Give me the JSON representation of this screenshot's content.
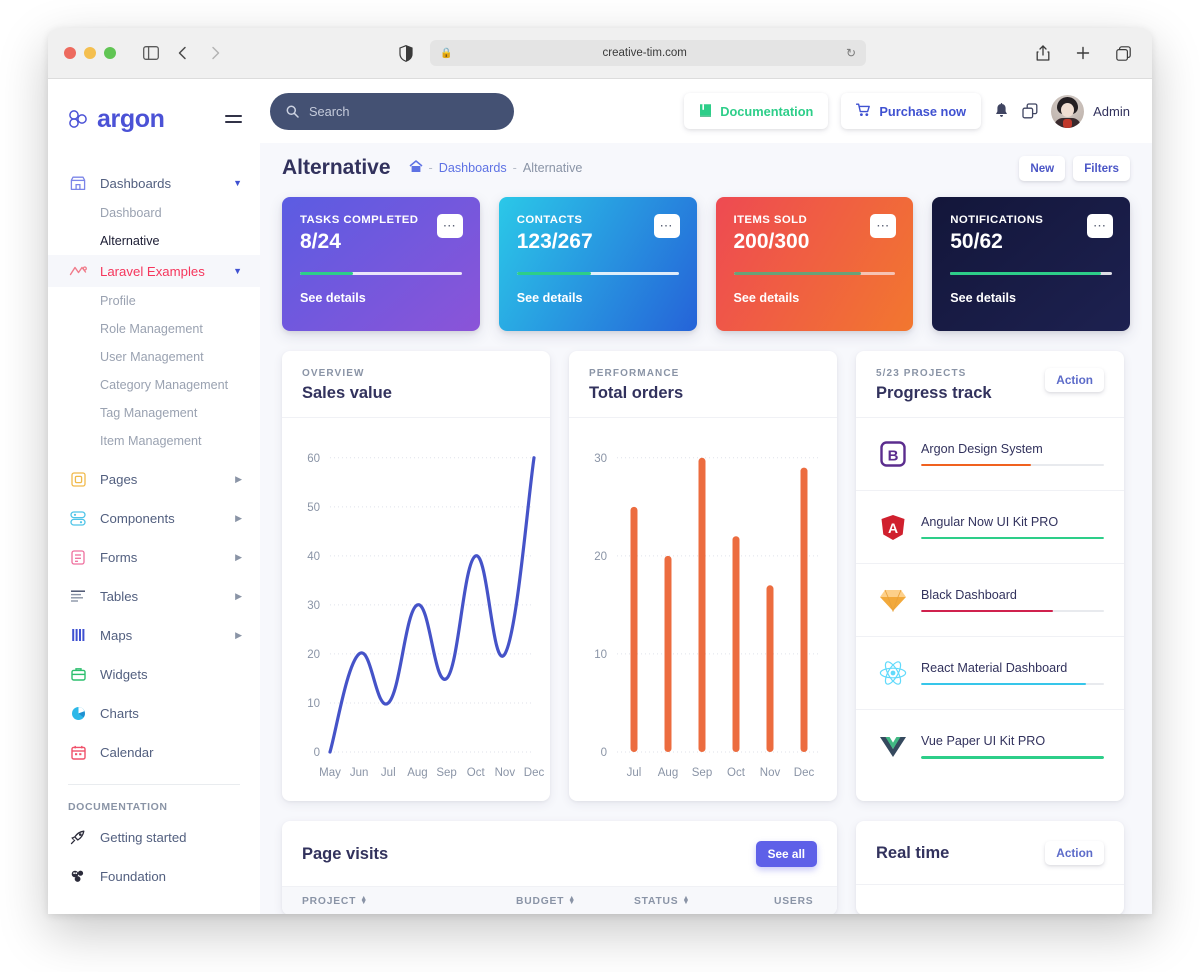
{
  "browser": {
    "url": "creative-tim.com",
    "lock_icon": "lock-icon",
    "reload_icon": "reload-icon"
  },
  "sidebar": {
    "logo_text": "argon",
    "items": [
      {
        "label": "Dashboards",
        "icon": "store-icon",
        "caret": "chevron-down-icon",
        "type": "parent"
      },
      {
        "label": "Dashboard",
        "type": "sub",
        "state": "dim"
      },
      {
        "label": "Alternative",
        "type": "sub",
        "state": "current"
      },
      {
        "label": "Laravel Examples",
        "icon": "laravel-icon",
        "caret": "chevron-down-icon",
        "type": "parent",
        "state": "active"
      },
      {
        "label": "Profile",
        "type": "sub",
        "state": "dim"
      },
      {
        "label": "Role Management",
        "type": "sub",
        "state": "dim"
      },
      {
        "label": "User Management",
        "type": "sub",
        "state": "dim"
      },
      {
        "label": "Category Management",
        "type": "sub",
        "state": "dim"
      },
      {
        "label": "Tag Management",
        "type": "sub",
        "state": "dim"
      },
      {
        "label": "Item Management",
        "type": "sub",
        "state": "dim"
      },
      {
        "label": "Pages",
        "icon": "pages-icon",
        "caret": "chevron-right-icon",
        "type": "parent"
      },
      {
        "label": "Components",
        "icon": "components-icon",
        "caret": "chevron-right-icon",
        "type": "parent"
      },
      {
        "label": "Forms",
        "icon": "forms-icon",
        "caret": "chevron-right-icon",
        "type": "parent"
      },
      {
        "label": "Tables",
        "icon": "tables-icon",
        "caret": "chevron-right-icon",
        "type": "parent"
      },
      {
        "label": "Maps",
        "icon": "maps-icon",
        "caret": "chevron-right-icon",
        "type": "parent"
      },
      {
        "label": "Widgets",
        "icon": "widgets-icon",
        "type": "parent"
      },
      {
        "label": "Charts",
        "icon": "charts-icon",
        "type": "parent"
      },
      {
        "label": "Calendar",
        "icon": "calendar-icon",
        "type": "parent"
      }
    ],
    "documentation_heading": "DOCUMENTATION",
    "doc_items": [
      {
        "label": "Getting started",
        "icon": "rocket-icon"
      },
      {
        "label": "Foundation",
        "icon": "atoms-icon"
      }
    ]
  },
  "topnav": {
    "search_placeholder": "Search",
    "search_icon": "search-icon",
    "documentation_label": "Documentation",
    "documentation_icon": "book-icon",
    "purchase_label": "Purchase now",
    "purchase_icon": "cart-icon",
    "bell_icon": "bell-icon",
    "apps_icon": "copy-icon",
    "user_name": "Admin",
    "avatar": "avatar"
  },
  "page": {
    "title": "Alternative",
    "breadcrumb": {
      "home_icon": "home-icon",
      "parent": "Dashboards",
      "current": "Alternative",
      "separator": "-"
    },
    "actions": [
      {
        "label": "New"
      },
      {
        "label": "Filters"
      }
    ]
  },
  "stats": [
    {
      "label": "TASKS COMPLETED",
      "value": "8/24",
      "progress": 33,
      "link": "See details",
      "gradient_from": "#5b5ce2",
      "gradient_to": "#8b54d8",
      "bar_color": "#2dce89",
      "menu_icon": "ellipsis-icon"
    },
    {
      "label": "CONTACTS",
      "value": "123/267",
      "progress": 46,
      "link": "See details",
      "gradient_from": "#2bc8e8",
      "gradient_to": "#2563d8",
      "bar_color": "#2dce89",
      "menu_icon": "ellipsis-icon"
    },
    {
      "label": "ITEMS SOLD",
      "value": "200/300",
      "progress": 79,
      "link": "See details",
      "gradient_from": "#ee4a52",
      "gradient_to": "#f2772f",
      "bar_color": "#5f9e6e",
      "menu_icon": "ellipsis-icon"
    },
    {
      "label": "NOTIFICATIONS",
      "value": "50/62",
      "progress": 93,
      "link": "See details",
      "gradient_from": "#14173a",
      "gradient_to": "#1b1f4b",
      "bar_color": "#2dce89",
      "menu_icon": "ellipsis-icon"
    }
  ],
  "chart_data": [
    {
      "type": "line",
      "title": "Sales value",
      "eyebrow": "OVERVIEW",
      "categories": [
        "May",
        "Jun",
        "Jul",
        "Aug",
        "Sep",
        "Oct",
        "Nov",
        "Dec"
      ],
      "values": [
        0,
        20,
        10,
        30,
        15,
        40,
        20,
        60
      ],
      "series": [
        {
          "name": "Sales value",
          "values": [
            0,
            20,
            10,
            30,
            15,
            40,
            20,
            60
          ]
        }
      ],
      "yticks": [
        0,
        10,
        20,
        30,
        40,
        50,
        60
      ],
      "ylim": [
        0,
        62
      ],
      "xlabel": "",
      "ylabel": "",
      "grid": true,
      "legend": "none",
      "line_color": "#4553c8"
    },
    {
      "type": "bar",
      "title": "Total orders",
      "eyebrow": "PERFORMANCE",
      "categories": [
        "Jul",
        "Aug",
        "Sep",
        "Oct",
        "Nov",
        "Dec"
      ],
      "values": [
        25,
        20,
        30,
        22,
        17,
        29
      ],
      "yticks": [
        0,
        10,
        20,
        30
      ],
      "ylim": [
        0,
        31
      ],
      "xlabel": "",
      "ylabel": "",
      "grid": true,
      "legend": "none",
      "bar_color": "#ec6c3f"
    }
  ],
  "progress_track": {
    "eyebrow": "5/23 PROJECTS",
    "title": "Progress track",
    "action_label": "Action",
    "projects": [
      {
        "name": "Argon Design System",
        "progress": 60,
        "color": "#f0611f",
        "logo": "bootstrap-icon"
      },
      {
        "name": "Angular Now UI Kit PRO",
        "progress": 100,
        "color": "#2dce89",
        "logo": "angular-icon"
      },
      {
        "name": "Black Dashboard",
        "progress": 72,
        "color": "#d0214d",
        "logo": "sketch-icon"
      },
      {
        "name": "React Material Dashboard",
        "progress": 90,
        "color": "#36c6ea",
        "logo": "react-icon"
      },
      {
        "name": "Vue Paper UI Kit PRO",
        "progress": 100,
        "color": "#2dce89",
        "logo": "vue-icon"
      }
    ]
  },
  "page_visits": {
    "title": "Page visits",
    "see_all_label": "See all",
    "columns": [
      "PROJECT",
      "BUDGET",
      "STATUS",
      "USERS"
    ],
    "sort_icon": "sort-icon"
  },
  "real_time": {
    "title": "Real time",
    "action_label": "Action"
  }
}
